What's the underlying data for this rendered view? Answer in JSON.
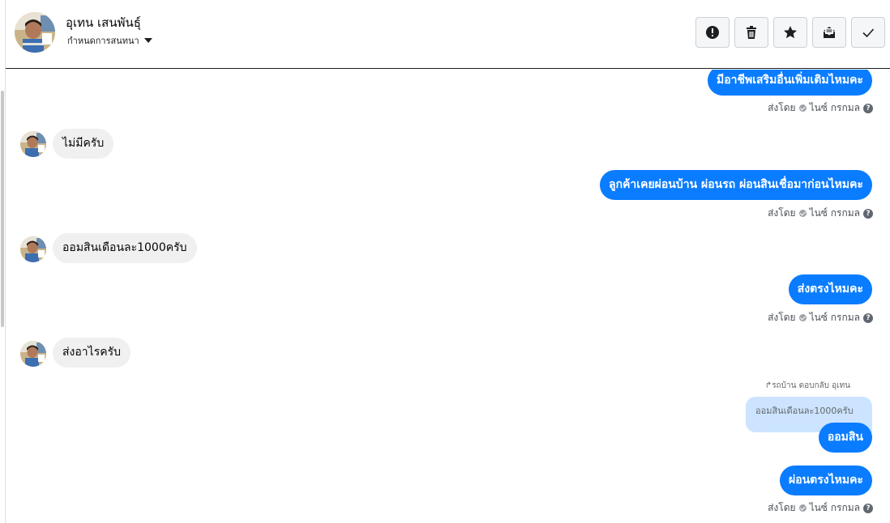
{
  "header": {
    "name": "อุเทน เสนพันธุ์",
    "assign_label": "กำหนดการสนทนา",
    "toolbar": [
      {
        "icon": "alert-icon",
        "title": "spam"
      },
      {
        "icon": "trash-icon",
        "title": "delete"
      },
      {
        "icon": "star-icon",
        "title": "star"
      },
      {
        "icon": "mark-unread-icon",
        "title": "unread"
      },
      {
        "icon": "check-icon",
        "title": "done"
      }
    ]
  },
  "sent_meta": {
    "prefix": "ส่งโดย",
    "sender": "ไนซ์ กรกมล",
    "help": "?"
  },
  "messages": [
    {
      "dir": "out",
      "text": "มีอาชีพเสริมอื่นเพิ่มเติมไหมคะ"
    },
    {
      "dir": "in",
      "text": "ไม่มีครับ"
    },
    {
      "dir": "out",
      "text": "ลูกค้าเคยผ่อนบ้าน ผ่อนรถ ผ่อนสินเชื่อมาก่อนไหมคะ"
    },
    {
      "dir": "in",
      "text": "ออมสินเดือนละ1000ครับ"
    },
    {
      "dir": "out",
      "text": "ส่งตรงไหมคะ"
    },
    {
      "dir": "in",
      "text": "ส่งอาไรครับ"
    },
    {
      "dir": "out",
      "text": "ออมสิน",
      "reply_note": "รถบ้าน ตอบกลับ อุเทน",
      "quoted": "ออมสินเดือนละ1000ครับ"
    },
    {
      "dir": "out",
      "text": "ผ่อนตรงไหมคะ"
    }
  ],
  "colors": {
    "outgoing": "#0a7cff",
    "incoming": "#f0f0f0",
    "quoted": "#cce4ff"
  }
}
